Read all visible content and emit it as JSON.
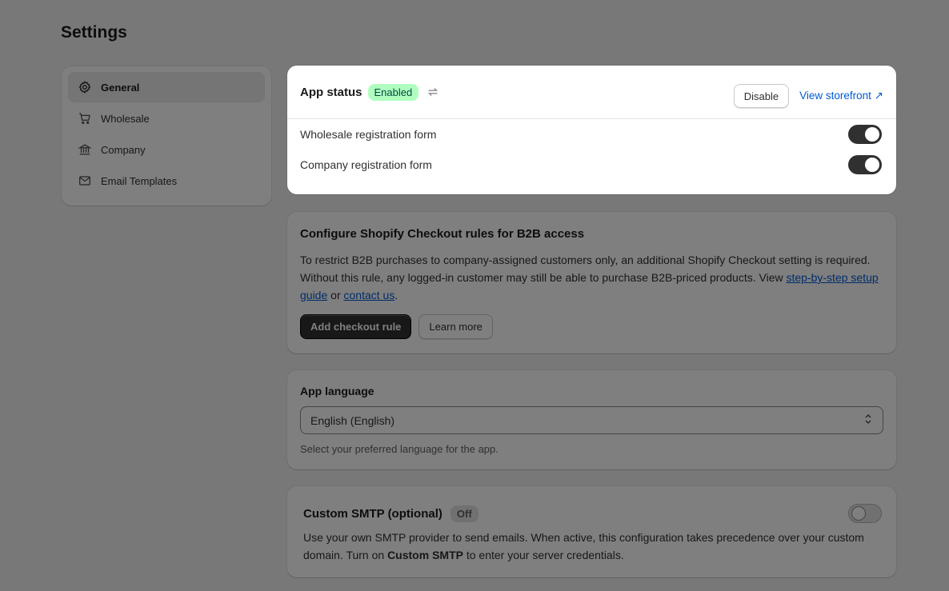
{
  "page": {
    "title": "Settings"
  },
  "sidebar": {
    "items": [
      {
        "label": "General",
        "icon": "gear-icon",
        "active": true
      },
      {
        "label": "Wholesale",
        "icon": "cart-icon"
      },
      {
        "label": "Company",
        "icon": "bank-icon"
      },
      {
        "label": "Email Templates",
        "icon": "mail-icon"
      }
    ]
  },
  "status": {
    "title": "App status",
    "badge": "Enabled",
    "disable_label": "Disable",
    "storefront_label": "View storefront ↗",
    "toggles": [
      {
        "label": "Wholesale registration form",
        "on": true
      },
      {
        "label": "Company registration form",
        "on": true
      }
    ]
  },
  "checkout": {
    "title": "Configure Shopify Checkout rules for B2B access",
    "desc_1": "To restrict B2B purchases to company-assigned customers only, an additional Shopify Checkout setting is required. Without this rule, any logged-in customer may still be able to purchase B2B-priced products. View ",
    "link_guide": "step-by-step setup guide",
    "desc_or": " or ",
    "link_contact": "contact us",
    "desc_end": ".",
    "primary_label": "Add checkout rule",
    "secondary_label": "Learn more"
  },
  "language": {
    "label": "App language",
    "selected": "English (English)",
    "help": "Select your preferred language for the app."
  },
  "smtp": {
    "title": "Custom SMTP (optional)",
    "badge": "Off",
    "desc_1": "Use your own SMTP provider to send emails. When active, this configuration takes precedence over your custom domain. Turn on ",
    "desc_bold": "Custom SMTP",
    "desc_2": " to enter your server credentials.",
    "on": false
  },
  "colors": {
    "overlay": "#000000",
    "accent": "#005bd3",
    "badge_enabled": "#affebf"
  }
}
